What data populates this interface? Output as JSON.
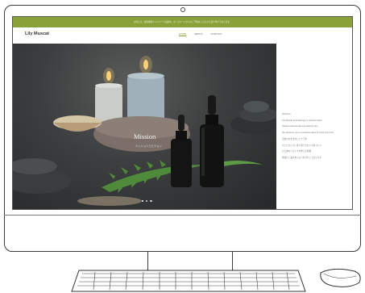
{
  "site": {
    "announcement": "お知らせ：送料無料キャンペーン実施中。ホームページからのご予約はこちらから受け付けております。",
    "logo": "Lily Muscat",
    "nav": [
      {
        "label": "HOME",
        "active": true
      },
      {
        "label": "ABOUT",
        "active": false
      },
      {
        "label": "CONTACT",
        "active": false
      }
    ],
    "hero": {
      "title": "Mission",
      "subtitle": "ミッションとビジョン"
    },
    "sidebar_lines": [
      "Welcome",
      "Lily Muscat aromatherapy & wellness salon",
      "Natural essential oils and relaxing care",
      "We welcome you to a peaceful place for body and mind",
      "自然の力を活かしたケアを",
      "ひとりひとりに寄り添うサロンでありたい",
      "心と体のバランスを整える時間",
      "皆様のご来店を心よりお待ちしております"
    ],
    "slider_dots": [
      true,
      false,
      false
    ]
  },
  "colors": {
    "accent": "#8aa13a",
    "hero_dark": "#2f3132"
  }
}
